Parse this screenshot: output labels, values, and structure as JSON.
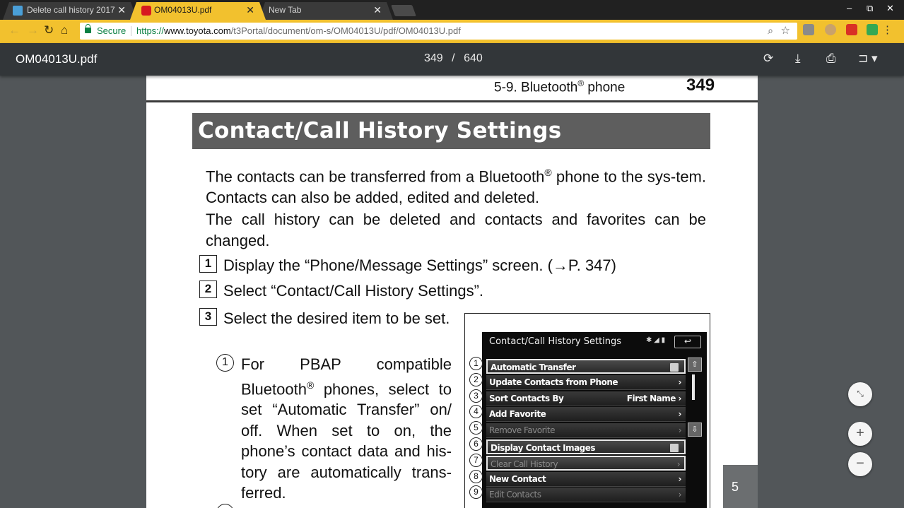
{
  "tabs": [
    {
      "title": "Delete call history 2017",
      "close": "✕"
    },
    {
      "title": "OM04013U.pdf",
      "close": "✕"
    },
    {
      "title": "New Tab",
      "close": "✕"
    }
  ],
  "window_controls": {
    "minimize": "–",
    "restore": "⧉",
    "close": "✕"
  },
  "toolbar": {
    "back": "←",
    "forward": "→",
    "reload": "↻",
    "home": "⌂",
    "secure_label": "Secure",
    "url_scheme": "https://",
    "url_domain": "www.toyota.com",
    "url_path": "/t3Portal/document/om-s/OM04013U/pdf/OM04013U.pdf",
    "zoom_glyph": "⌕",
    "star_glyph": "☆",
    "menu_glyph": "⋮"
  },
  "pdf_viewer": {
    "filename": "OM04013U.pdf",
    "current_page": "349",
    "page_separator": "/",
    "total_pages": "640",
    "rotate_glyph": "⟳",
    "download_glyph": "⤓",
    "print_glyph": "⎙",
    "bookmark_glyph": "⊐ ▾"
  },
  "page": {
    "running_head_text": "5-9. Bluetooth",
    "running_head_reg": "®",
    "running_head_tail": " phone",
    "page_number": "349",
    "heading": "Contact/Call History Settings",
    "para1_a": "The contacts can be transferred from a Bluetooth",
    "para1_reg": "®",
    "para1_b": " phone to the sys-tem. Contacts can also be added, edited and deleted.",
    "para2": "The call history can be deleted and contacts and favorites can be changed.",
    "steps": [
      {
        "num": "1",
        "text": "Display the “Phone/Message Settings” screen. (→P. 347)"
      },
      {
        "num": "2",
        "text": "Select “Contact/Call History Settings”."
      },
      {
        "num": "3",
        "text": "Select the desired item to be set."
      }
    ],
    "sub1_num": "1",
    "sub1_a": "For PBAP compatible Bluetooth",
    "sub1_reg": "®",
    "sub1_b": " phones, select to set “Automatic Transfer” on/ off. When set to on, the phone’s contact data and his-tory are automatically trans-ferred."
  },
  "screen": {
    "title": "Contact/Call History Settings",
    "status": "✱ ◢ ▮",
    "back_glyph": "↩",
    "scroll_up": "⇧",
    "scroll_down": "⇩",
    "items": [
      {
        "num": "1",
        "label": "Automatic Transfer",
        "value": "",
        "chevron": "",
        "check": true,
        "dim": false,
        "hl": true
      },
      {
        "num": "2",
        "label": "Update Contacts from Phone",
        "value": "",
        "chevron": "›",
        "check": false,
        "dim": false,
        "hl": false
      },
      {
        "num": "3",
        "label": "Sort Contacts By",
        "value": "First Name ›",
        "chevron": "",
        "check": false,
        "dim": false,
        "hl": false
      },
      {
        "num": "4",
        "label": "Add Favorite",
        "value": "",
        "chevron": "›",
        "check": false,
        "dim": false,
        "hl": false
      },
      {
        "num": "5",
        "label": "Remove Favorite",
        "value": "",
        "chevron": "›",
        "check": false,
        "dim": true,
        "hl": false
      },
      {
        "num": "6",
        "label": "Display Contact Images",
        "value": "",
        "chevron": "",
        "check": true,
        "dim": false,
        "hl": true
      },
      {
        "num": "7",
        "label": "Clear Call History",
        "value": "",
        "chevron": "›",
        "check": false,
        "dim": true,
        "hl": true
      },
      {
        "num": "8",
        "label": "New Contact",
        "value": "",
        "chevron": "›",
        "check": false,
        "dim": false,
        "hl": false
      },
      {
        "num": "9",
        "label": "Edit Contacts",
        "value": "",
        "chevron": "›",
        "check": false,
        "dim": true,
        "hl": false
      }
    ]
  },
  "floating": {
    "page_indicator": "5",
    "fit_glyph": "⤡",
    "zoom_in": "+",
    "zoom_out": "−"
  },
  "colors": {
    "toolbar_yellow": "#f2c12e",
    "pdf_toolbar": "#323639",
    "viewer_bg": "#525659",
    "heading_bar": "#5e5e5e",
    "secure_green": "#0b8043"
  }
}
